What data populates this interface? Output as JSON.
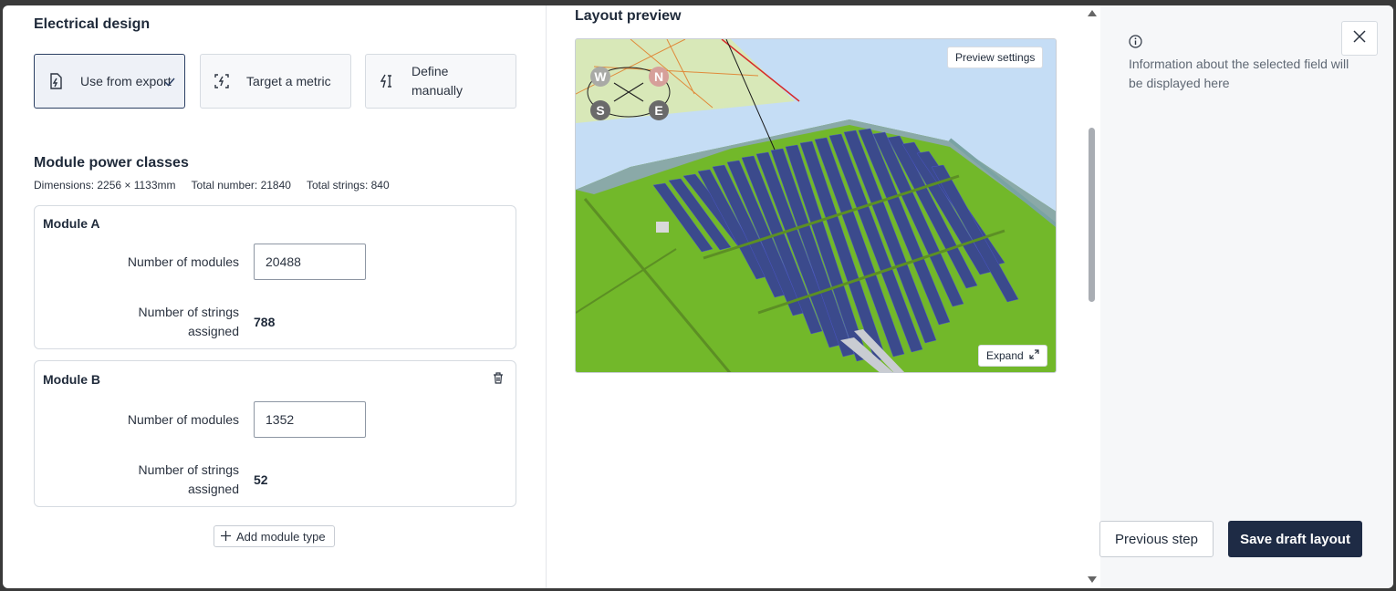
{
  "electrical": {
    "title": "Electrical design",
    "options": [
      {
        "label": "Use from export",
        "icon": "document-bolt-icon",
        "selected": true
      },
      {
        "label": "Target a metric",
        "icon": "target-bolt-icon",
        "selected": false
      },
      {
        "label": "Define manually",
        "icon": "bolt-cursor-icon",
        "selected": false
      }
    ]
  },
  "module_classes": {
    "title": "Module power classes",
    "dimensions": "Dimensions: 2256 × 1133mm",
    "total_number": "Total number: 21840",
    "total_strings": "Total strings: 840",
    "modules": [
      {
        "name": "Module A",
        "num_label": "Number of modules",
        "num_value": "20488",
        "strings_label": "Number of strings assigned",
        "strings_value": "788"
      },
      {
        "name": "Module B",
        "num_label": "Number of modules",
        "num_value": "1352",
        "strings_label": "Number of strings assigned",
        "strings_value": "52"
      }
    ],
    "add_label": "Add module type"
  },
  "preview": {
    "title": "Layout preview",
    "settings_label": "Preview settings",
    "expand_label": "Expand",
    "compass": {
      "w": "W",
      "n": "N",
      "s": "S",
      "e": "E"
    }
  },
  "side_panel": {
    "info": "Information about the selected field will be displayed here"
  },
  "footer": {
    "previous_label": "Previous step",
    "save_label": "Save draft layout"
  },
  "colors": {
    "primary": "#1e2b45",
    "selected_border": "#2b3f63",
    "grass": "#72b82a",
    "sky": "#c5ddf5",
    "panel_blue": "#3b4a8c"
  }
}
